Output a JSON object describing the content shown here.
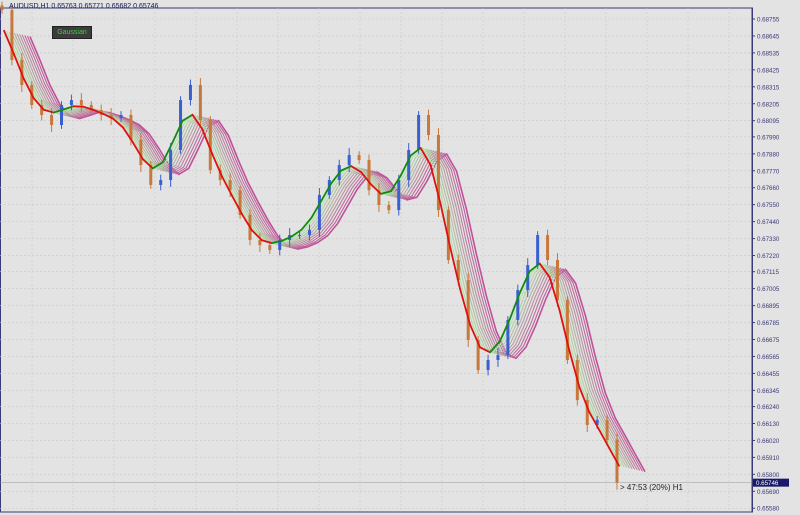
{
  "header": {
    "title": "AUDUSD,H1  0.65763 0.65771 0.65682 0.65746"
  },
  "indicator_button": {
    "label": "Gaussian"
  },
  "timer_label": "> 47:53 (20%) H1",
  "colors": {
    "background": "#e3e3e3",
    "grid": "#c8c8c8",
    "bull_candle": "#3a5fd0",
    "bear_candle": "#c8783a",
    "ma_down": "#e01010",
    "ma_up": "#108a10",
    "ribbon_inner": "#aef0a8",
    "ribbon_outer": "#c0509a",
    "axis": "#3a3a7a"
  },
  "chart_data": {
    "type": "candlestick",
    "symbol": "AUDUSD",
    "timeframe": "H1",
    "current_price": "0.65746",
    "y_ticks": [
      "0.68755",
      "0.68645",
      "0.68535",
      "0.68425",
      "0.68315",
      "0.68205",
      "0.68095",
      "0.67990",
      "0.67880",
      "0.67770",
      "0.67660",
      "0.67550",
      "0.67440",
      "0.67330",
      "0.67220",
      "0.67115",
      "0.67005",
      "0.66895",
      "0.66785",
      "0.66675",
      "0.66565",
      "0.66455",
      "0.66345",
      "0.66240",
      "0.66130",
      "0.66020",
      "0.65910",
      "0.65800",
      "0.65690",
      "0.65580"
    ],
    "ylim": [
      0.6557,
      0.6886
    ],
    "grid": true,
    "closes": [
      0.68813,
      0.68489,
      0.68327,
      0.68197,
      0.68132,
      0.68067,
      0.68197,
      0.68229,
      0.68197,
      0.68164,
      0.68132,
      0.68112,
      0.68132,
      0.6797,
      0.67807,
      0.67678,
      0.6771,
      0.67905,
      0.68229,
      0.68327,
      0.681,
      0.67775,
      0.6771,
      0.67645,
      0.67483,
      0.67321,
      0.67288,
      0.67256,
      0.67321,
      0.67353,
      0.67353,
      0.67386,
      0.67613,
      0.6771,
      0.67807,
      0.67872,
      0.6784,
      0.67645,
      0.67548,
      0.67515,
      0.6771,
      0.67905,
      0.68132,
      0.68002,
      0.67515,
      0.67191,
      0.67061,
      0.66672,
      0.66477,
      0.66542,
      0.66574,
      0.66802,
      0.66996,
      0.67158,
      0.67353,
      0.67191,
      0.66931,
      0.66542,
      0.66282,
      0.6612,
      0.66153,
      0.66023,
      0.65746
    ],
    "indicator": "Gaussian"
  }
}
